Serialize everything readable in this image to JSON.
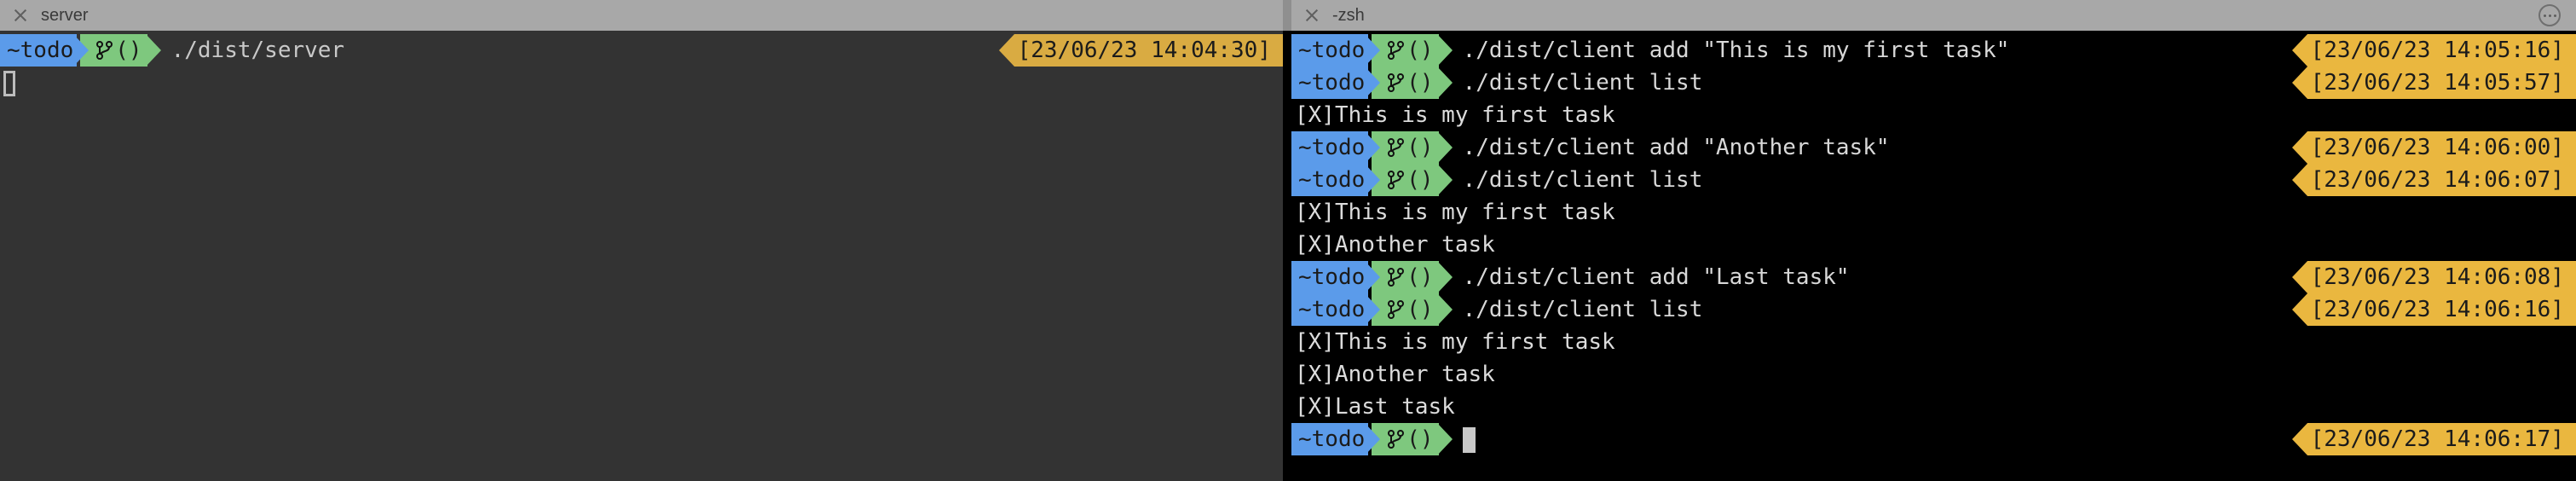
{
  "window": {
    "tabs": [
      {
        "label": "server",
        "close_icon": "close-icon"
      },
      {
        "label": "-zsh",
        "close_icon": "close-icon"
      }
    ],
    "more_options_icon": "ellipsis-circle-icon"
  },
  "colors": {
    "tabbar_bg": "#a8a8a8",
    "pane_left_bg": "#333333",
    "pane_right_bg": "#000000",
    "prompt_dir_bg": "#5b9bea",
    "prompt_git_bg": "#7ec87e",
    "timestamp_bg": "#eab73f",
    "text_fg": "#dcdcdc"
  },
  "prompt": {
    "dir": "~todo",
    "git_icon": "git-branch-icon",
    "git_text": "()"
  },
  "left_pane": {
    "title": "server",
    "lines": [
      {
        "type": "command",
        "dir": "~todo",
        "git": "()",
        "command": "./dist/server",
        "timestamp": "[23/06/23 14:04:30]"
      },
      {
        "type": "cursor",
        "cursor": "hollow"
      }
    ]
  },
  "right_pane": {
    "title": "-zsh",
    "lines": [
      {
        "type": "command",
        "dir": "~todo",
        "git": "()",
        "command": "./dist/client add \"This is my first task\"",
        "timestamp": "[23/06/23 14:05:16]"
      },
      {
        "type": "command",
        "dir": "~todo",
        "git": "()",
        "command": "./dist/client list",
        "timestamp": "[23/06/23 14:05:57]"
      },
      {
        "type": "output",
        "text": "[X]This is my first task"
      },
      {
        "type": "command",
        "dir": "~todo",
        "git": "()",
        "command": "./dist/client add \"Another task\"",
        "timestamp": "[23/06/23 14:06:00]"
      },
      {
        "type": "command",
        "dir": "~todo",
        "git": "()",
        "command": "./dist/client list",
        "timestamp": "[23/06/23 14:06:07]"
      },
      {
        "type": "output",
        "text": "[X]This is my first task"
      },
      {
        "type": "output",
        "text": "[X]Another task"
      },
      {
        "type": "command",
        "dir": "~todo",
        "git": "()",
        "command": "./dist/client add \"Last task\"",
        "timestamp": "[23/06/23 14:06:08]"
      },
      {
        "type": "command",
        "dir": "~todo",
        "git": "()",
        "command": "./dist/client list",
        "timestamp": "[23/06/23 14:06:16]"
      },
      {
        "type": "output",
        "text": "[X]This is my first task"
      },
      {
        "type": "output",
        "text": "[X]Another task"
      },
      {
        "type": "output",
        "text": "[X]Last task"
      },
      {
        "type": "command",
        "dir": "~todo",
        "git": "()",
        "command": "",
        "cursor": "block",
        "timestamp": "[23/06/23 14:06:17]"
      }
    ]
  }
}
